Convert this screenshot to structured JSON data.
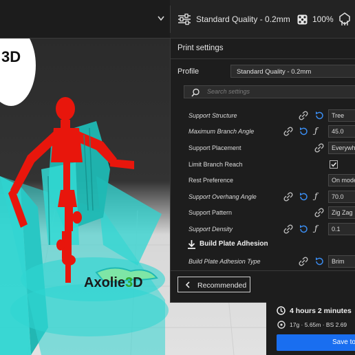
{
  "topbar": {
    "quality": "Standard Quality - 0.2mm",
    "infill": "100%"
  },
  "print_settings": {
    "title": "Print settings",
    "profile_label": "Profile",
    "profile_value": "Standard Quality - 0.2mm",
    "search_placeholder": "Search settings",
    "rows": [
      {
        "label": "Support Structure",
        "value": "Tree"
      },
      {
        "label": "Maximum Branch Angle",
        "value": "45.0"
      },
      {
        "label": "Support Placement",
        "value": "Everywhere"
      },
      {
        "label": "Limit Branch Reach",
        "value": ""
      },
      {
        "label": "Rest Preference",
        "value": "On model"
      },
      {
        "label": "Support Overhang Angle",
        "value": "70.0"
      },
      {
        "label": "Support Pattern",
        "value": "Zig Zag"
      },
      {
        "label": "Support Density",
        "value": "0.1"
      }
    ],
    "section_adhesion": "Build Plate Adhesion",
    "adhesion_row": {
      "label": "Build Plate Adhesion Type",
      "value": "Brim"
    },
    "recommended_label": "Recommended"
  },
  "estimate": {
    "time": "4 hours 2 minutes",
    "material": "17g · 5.65m · BS 2.69",
    "save_label": "Save to"
  },
  "logo": {
    "text_a": "Axolie",
    "text_b": "3",
    "text_c": "D",
    "corner_text": "3D"
  },
  "colors": {
    "accent": "#196ef0",
    "support": "#2fd6d2",
    "model": "#e8160c",
    "link_icon": "#bcbcbc",
    "reset_icon": "#3a8cf0"
  }
}
